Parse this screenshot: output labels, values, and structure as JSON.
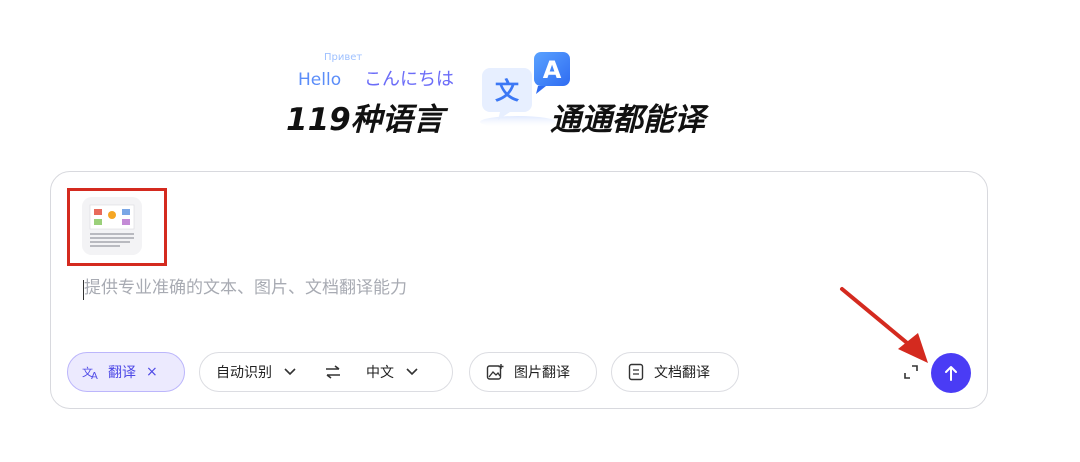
{
  "hero": {
    "word_ru": "Привет",
    "word_en": "Hello",
    "word_ja": "こんにちは",
    "headline_left": "119种语言",
    "headline_right": "通通都能译",
    "badge_char_zh": "文",
    "badge_char_en": "A"
  },
  "composer": {
    "placeholder": "提供专业准确的文本、图片、文档翻译能力",
    "attachment": "uploaded-image-thumbnail"
  },
  "toolbar": {
    "translate_label": "翻译",
    "translate_remove": "×",
    "source_lang": "自动识别",
    "target_lang": "中文",
    "image_translate_label": "图片翻译",
    "doc_translate_label": "文档翻译"
  },
  "colors": {
    "accent": "#4a3cf5",
    "annotation": "#d42a1f",
    "chip_active_bg": "#eceafe"
  }
}
